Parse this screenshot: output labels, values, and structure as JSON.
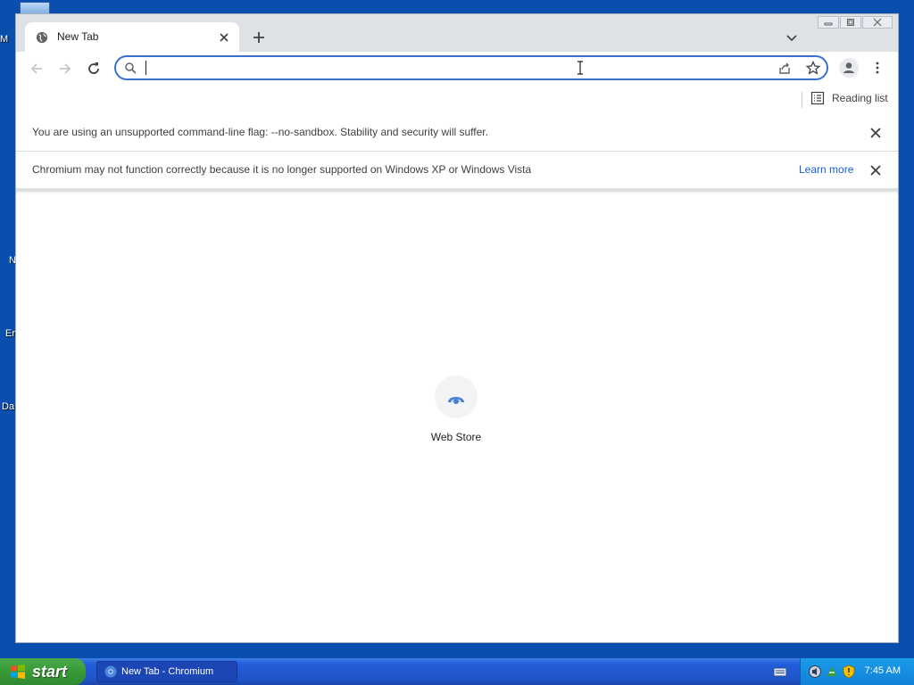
{
  "desktop": {
    "icon_fragments": [
      "M",
      "N",
      "Er",
      "Da"
    ]
  },
  "browser": {
    "tab": {
      "title": "New Tab",
      "icon": "globe-icon"
    },
    "omnibox": {
      "value": "",
      "placeholder": ""
    },
    "bookmarks": {
      "reading_list_label": "Reading list"
    },
    "infobars": [
      {
        "text": "You are using an unsupported command-line flag: --no-sandbox. Stability and security will suffer."
      },
      {
        "text": "Chromium may not function correctly because it is no longer supported on Windows XP or Windows Vista",
        "link": "Learn more"
      }
    ],
    "shortcut": {
      "label": "Web Store"
    }
  },
  "taskbar": {
    "start_label": "start",
    "task_item": "New Tab - Chromium",
    "clock": "7:45 AM"
  },
  "colors": {
    "accent": "#1a5ed6",
    "desktop": "#0b4fae",
    "start_green": "#3a9d3a",
    "taskbar_blue": "#245edb"
  }
}
